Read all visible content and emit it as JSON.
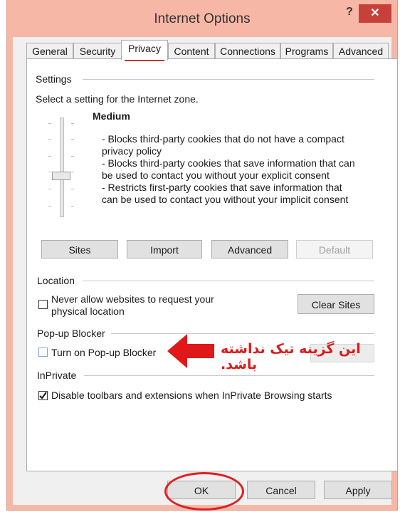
{
  "window": {
    "title": "Internet Options",
    "help": "?",
    "close": "✕"
  },
  "tabs": [
    {
      "label": "General"
    },
    {
      "label": "Security"
    },
    {
      "label": "Privacy"
    },
    {
      "label": "Content"
    },
    {
      "label": "Connections"
    },
    {
      "label": "Programs"
    },
    {
      "label": "Advanced"
    }
  ],
  "settings": {
    "heading": "Settings",
    "intro": "Select a setting for the Internet zone.",
    "level": "Medium",
    "desc": [
      "- Blocks third-party cookies that do not have a compact",
      "privacy policy",
      "- Blocks third-party cookies that save information that can",
      "be used to contact you without your explicit consent",
      "- Restricts first-party cookies that save information that",
      "can be used to contact you without your implicit consent"
    ],
    "buttons": {
      "sites": "Sites",
      "import": "Import",
      "advanced": "Advanced",
      "default": "Default"
    }
  },
  "location": {
    "heading": "Location",
    "checkbox_line1": "Never allow websites to request your",
    "checkbox_line2": "physical location",
    "checked": false,
    "clear_sites": "Clear Sites"
  },
  "popup": {
    "heading": "Pop-up Blocker",
    "checkbox": "Turn on Pop-up Blocker",
    "checked": false,
    "annotation": "این گزینه تیک نداشته باشد."
  },
  "inprivate": {
    "heading": "InPrivate",
    "checkbox": "Disable toolbars and extensions when InPrivate Browsing starts",
    "checked": true
  },
  "footer": {
    "ok": "OK",
    "cancel": "Cancel",
    "apply": "Apply"
  },
  "colors": {
    "accent": "#e02020",
    "close_bg": "#c7413a",
    "frame": "#f7b7a6"
  }
}
